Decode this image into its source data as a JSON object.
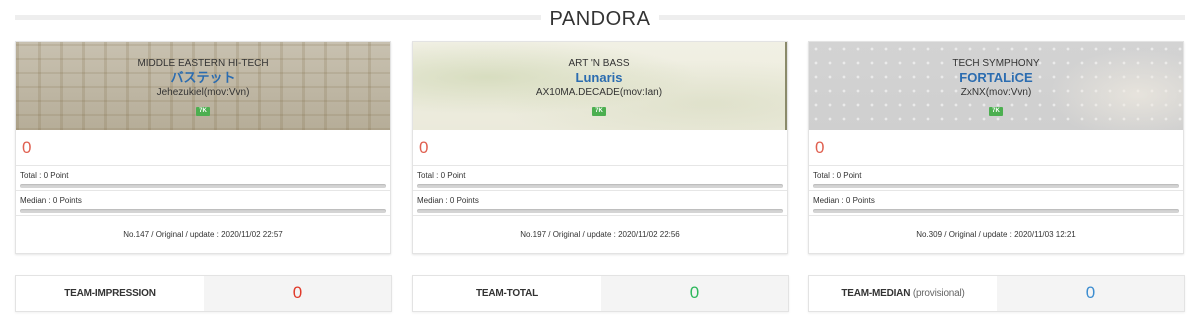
{
  "title": "PANDORA",
  "cards": [
    {
      "genre": "MIDDLE EASTERN HI-TECH",
      "song": "バステット",
      "artist": "Jehezukiel(mov:Vvn)",
      "difficulty_badge": "7K",
      "score": "0",
      "total_label": "Total : 0 Point",
      "total_progress": 0,
      "median_label": "Median : 0 Points",
      "median_progress": 0,
      "footer": "No.147 / Original / update : 2020/11/02 22:57"
    },
    {
      "genre": "ART 'N BASS",
      "song": "Lunaris",
      "artist": "AX10MA.DECADE(mov:Ian)",
      "difficulty_badge": "7K",
      "score": "0",
      "total_label": "Total : 0 Point",
      "total_progress": 0,
      "median_label": "Median : 0 Points",
      "median_progress": 0,
      "footer": "No.197 / Original / update : 2020/11/02 22:56"
    },
    {
      "genre": "TECH SYMPHONY",
      "song": "FORTALiCE",
      "artist": "ZxNX(mov:Vvn)",
      "difficulty_badge": "7K",
      "score": "0",
      "total_label": "Total : 0 Point",
      "total_progress": 0,
      "median_label": "Median : 0 Points",
      "median_progress": 0,
      "footer": "No.309 / Original / update : 2020/11/03 12:21"
    }
  ],
  "team": {
    "impression": {
      "label": "TEAM-IMPRESSION",
      "value": "0"
    },
    "total": {
      "label": "TEAM-TOTAL",
      "value": "0"
    },
    "median": {
      "label": "TEAM-MEDIAN",
      "sub": "(provisional)",
      "value": "0"
    }
  },
  "colors": {
    "song_title": "#2b6cb0",
    "score": "#e06050",
    "badge": "#4caf50",
    "team_impression": "#e03a2a",
    "team_total": "#2eb85c",
    "team_median": "#3c8dd0"
  }
}
